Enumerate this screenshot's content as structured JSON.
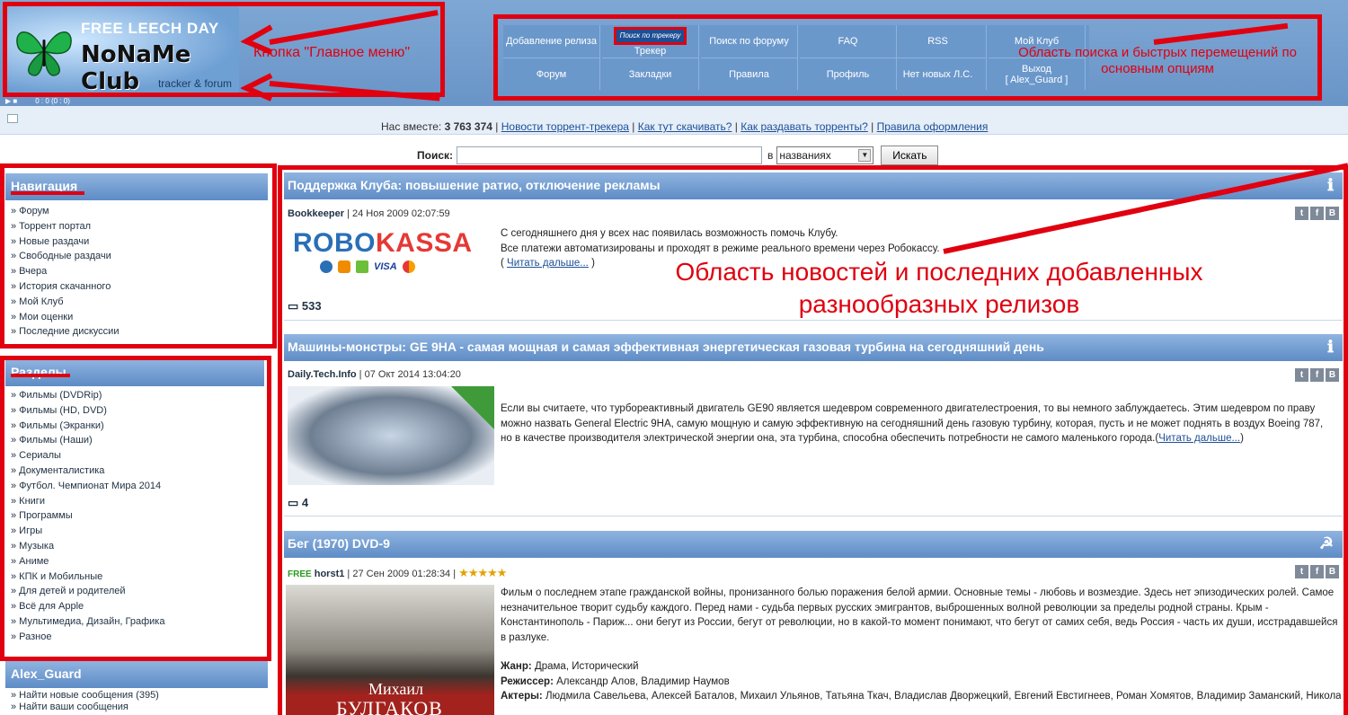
{
  "header": {
    "logo_top": "FREE LEECH DAY",
    "logo_name": "NoNaMe Club",
    "logo_sub": "tracker & forum",
    "player_text": "0 : 0     (0 : 0)",
    "annotation_main_menu": "Кнопка \"Главное меню\"",
    "annotation_search_area": "Область поиска и быстрых перемещений по основным опциям",
    "nav_row1": [
      {
        "label": "Добавление релиза"
      },
      {
        "label_highlight": "Поиск по трекеру",
        "label": "Трекер"
      },
      {
        "label": "Поиск по форуму"
      },
      {
        "label": "FAQ"
      },
      {
        "label": "RSS"
      },
      {
        "label": "Мой Клуб"
      }
    ],
    "nav_row2": [
      {
        "label": "Форум"
      },
      {
        "label": "Закладки"
      },
      {
        "label": "Правила"
      },
      {
        "label": "Профиль"
      },
      {
        "label": "Нет новых Л.С."
      },
      {
        "label": "Выход",
        "label2": "[ Alex_Guard ]"
      }
    ]
  },
  "strip": {
    "together_label": "Нас вместе:",
    "together_count": "3 763 374",
    "links": [
      "Новости торрент-трекера",
      "Как тут скачивать?",
      "Как раздавать торренты?",
      "Правила оформления"
    ]
  },
  "search": {
    "label": "Поиск:",
    "value": "",
    "in_label": "в",
    "scope": "названиях",
    "button": "Искать"
  },
  "sidebar": {
    "navigation": {
      "title": "Навигация",
      "items": [
        "» Форум",
        "» Торрент портал",
        "» Новые раздачи",
        "» Свободные раздачи",
        "» Вчера",
        "» История скачанного",
        "» Мой Клуб",
        "» Мои оценки",
        "» Последние дискуссии"
      ]
    },
    "sections": {
      "title": "Разделы",
      "items": [
        "» Фильмы (DVDRip)",
        "» Фильмы (HD, DVD)",
        "» Фильмы (Экранки)",
        "» Фильмы (Наши)",
        "» Сериалы",
        "» Документалистика",
        "» Футбол. Чемпионат Мира 2014",
        "» Книги",
        "» Программы",
        "» Игры",
        "» Музыка",
        "» Аниме",
        "» КПК и Мобильные",
        "» Для детей и родителей",
        "» Всё для Apple",
        "» Мультимедиа, Дизайн, Графика",
        "» Разное"
      ]
    },
    "user": {
      "title": "Alex_Guard",
      "items": [
        "» Найти новые сообщения (395)",
        "» Найти ваши сообщения"
      ]
    }
  },
  "news_annotation": "Область новостей и последних добавленных разнообразных релизов",
  "news": [
    {
      "title": "Поддержка Клуба: повышение ратио, отключение рекламы",
      "author": "Bookkeeper",
      "date": "24 Ноя 2009 02:07:59",
      "line1": "С сегодняшнего дня у всех нас появилась возможность помочь Клубу.",
      "line2": "Все платежи автоматизированы и проходят в режиме реального времени через Робокассу.",
      "read_more": "Читать дальше...",
      "comments": "533",
      "image_text_a": "ROBO",
      "image_text_b": "KASSA",
      "image_text_visa": "VISA"
    },
    {
      "title": "Машины-монстры: GE 9HA - самая мощная и самая эффективная энергетическая газовая турбина на сегодняшний день",
      "author": "Daily.Tech.Info",
      "date": "07 Окт 2014 13:04:20",
      "body": "Если вы считаете, что турбореактивный двигатель GE90 является шедевром современного двигателестроения, то вы немного заблуждаетесь. Этим шедевром по праву можно назвать General Electric 9HA, самую мощную и самую эффективную на сегодняшний день газовую турбину, которая, пусть и не может поднять в воздух Boeing 787, но в качестве производителя электрической энергии она, эта турбина, способна обеспечить потребности не самого маленького города.",
      "read_more": "Читать дальше...",
      "comments": "4"
    },
    {
      "title": "Бег (1970) DVD-9",
      "free_label": "FREE",
      "author": "horst1",
      "date": "27 Сен 2009 01:28:34",
      "stars": "★★★★★",
      "body": "Фильм о последнем этапе гражданской войны, пронизанного болью поражения белой армии. Основные темы - любовь и возмездие. Здесь нет эпизодических ролей. Самое незначительное творит судьбу каждого. Перед нами - судьба первых русских эмигрантов, выброшенных волной революции за пределы родной страны. Крым - Константинополь - Париж... они бегут из России, бегут от революции, но в какой-то момент понимают, что бегут от самих себя, ведь Россия - часть их души, исстрадавшейся в разлуке.",
      "genre_label": "Жанр:",
      "genre": "Драма, Исторический",
      "director_label": "Режиссер:",
      "director": "Александр Алов, Владимир Наумов",
      "actors_label": "Актеры:",
      "actors": "Людмила Савельева, Алексей Баталов, Михаил Ульянов, Татьяна Ткач, Владислав Дворжецкий, Евгений Евстигнеев, Роман Хомятов, Владимир Заманский, Николай",
      "poster_line1": "Михаил",
      "poster_line2": "БУЛГАКОВ"
    }
  ],
  "colors": {
    "annotation_red": "#e0000f",
    "header_blue": "#6994c7",
    "link_blue": "#1d4f95"
  }
}
